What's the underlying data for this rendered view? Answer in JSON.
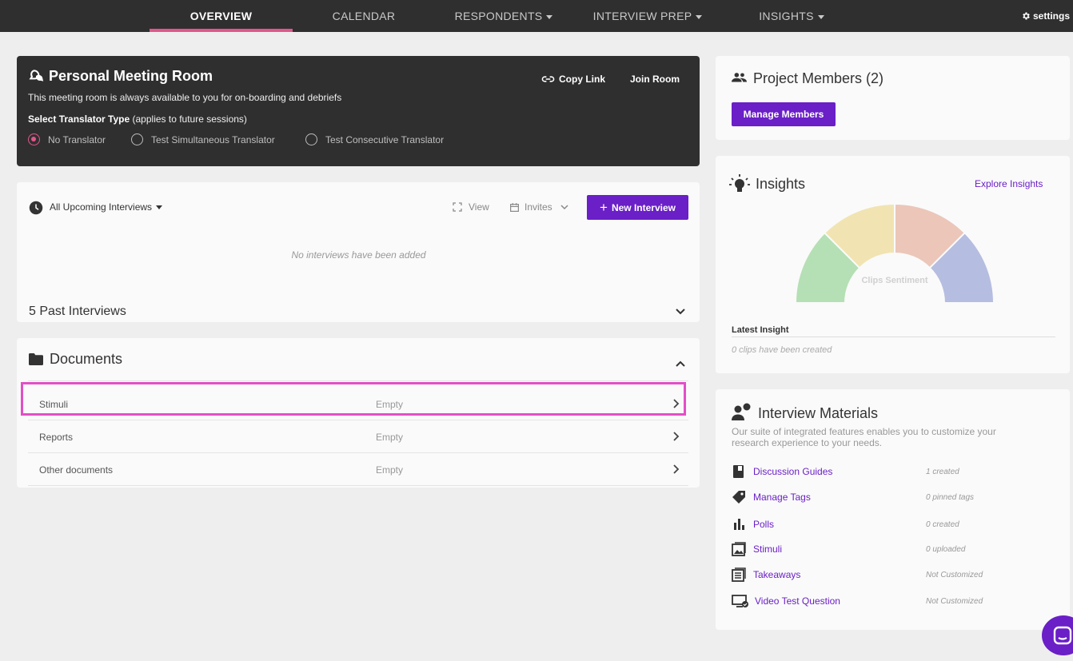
{
  "nav": {
    "overview": "OVERVIEW",
    "calendar": "CALENDAR",
    "respondents": "RESPONDENTS",
    "interview_prep": "INTERVIEW PREP",
    "insights": "INSIGHTS",
    "settings": "settings"
  },
  "meeting_room": {
    "title": "Personal Meeting Room",
    "description": "This meeting room is always available to you for on-boarding and debriefs",
    "translator_label": "Select Translator Type",
    "translator_note": " (applies to future sessions)",
    "options": [
      "No Translator",
      "Test Simultaneous Translator",
      "Test Consecutive Translator"
    ],
    "copy_link": "Copy Link",
    "join_room": "Join Room"
  },
  "interviews": {
    "filter": "All Upcoming Interviews",
    "view": "View",
    "invites": "Invites",
    "new_interview": "New Interview",
    "empty": "No interviews have been added",
    "past": "5 Past Interviews"
  },
  "documents": {
    "title": "Documents",
    "rows": [
      {
        "name": "Stimuli",
        "status": "Empty"
      },
      {
        "name": "Reports",
        "status": "Empty"
      },
      {
        "name": "Other documents",
        "status": "Empty"
      }
    ]
  },
  "members": {
    "title": "Project Members (2)",
    "manage": "Manage Members"
  },
  "insights": {
    "title": "Insights",
    "explore": "Explore Insights",
    "gauge_label": "Clips Sentiment",
    "latest_label": "Latest Insight",
    "latest_empty": "0 clips have been created",
    "segment_colors": [
      "#b5dfb4",
      "#f1e4b2",
      "#ebc6b9",
      "#b5bde0"
    ]
  },
  "materials": {
    "title": "Interview Materials",
    "description": "Our suite of integrated features enables you to customize your research experience to your needs.",
    "items": [
      {
        "label": "Discussion Guides",
        "status": "1 created",
        "icon": "book-icon"
      },
      {
        "label": "Manage Tags",
        "status": "0 pinned tags",
        "icon": "tag-icon"
      },
      {
        "label": "Polls",
        "status": "0 created",
        "icon": "bar-chart-icon"
      },
      {
        "label": "Stimuli",
        "status": "0 uploaded",
        "icon": "image-icon"
      },
      {
        "label": "Takeaways",
        "status": "Not Customized",
        "icon": "list-icon"
      },
      {
        "label": "Video Test Question",
        "status": "Not Customized",
        "icon": "monitor-check-icon"
      }
    ]
  },
  "colors": {
    "accent_purple": "#6a1fc7",
    "accent_pink": "#e0578b",
    "highlight": "#e24fc6"
  }
}
